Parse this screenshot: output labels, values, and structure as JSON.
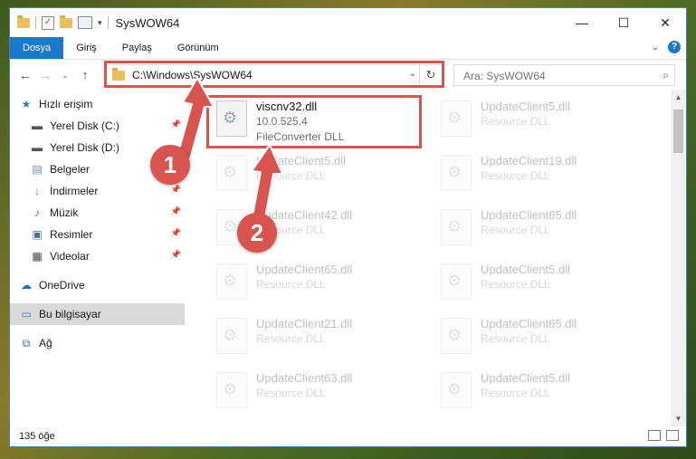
{
  "window": {
    "title": "SysWOW64",
    "controls": {
      "minimize": "—",
      "maximize": "☐",
      "close": "✕"
    }
  },
  "ribbon": {
    "tabs": [
      "Dosya",
      "Giriş",
      "Paylaş",
      "Görünüm"
    ]
  },
  "nav": {
    "address": "C:\\Windows\\SysWOW64",
    "search_placeholder": "Ara: SysWOW64"
  },
  "sidebar": {
    "items": [
      {
        "label": "Hızlı erişim",
        "icon": "star-icon"
      },
      {
        "label": "Yerel Disk (C:)",
        "icon": "drive-icon"
      },
      {
        "label": "Yerel Disk (D:)",
        "icon": "drive-icon"
      },
      {
        "label": "Belgeler",
        "icon": "documents-icon"
      },
      {
        "label": "İndirmeler",
        "icon": "download-icon"
      },
      {
        "label": "Müzik",
        "icon": "music-icon"
      },
      {
        "label": "Resimler",
        "icon": "pictures-icon"
      },
      {
        "label": "Videolar",
        "icon": "video-icon"
      },
      {
        "label": "OneDrive",
        "icon": "cloud-icon"
      },
      {
        "label": "Bu bilgisayar",
        "icon": "computer-icon"
      },
      {
        "label": "Ağ",
        "icon": "network-icon"
      }
    ]
  },
  "files": [
    {
      "name": "viscnv32.dll",
      "version": "10.0.525.4",
      "desc": "FileConverter DLL"
    },
    {
      "name": "UpdateClient5.dll",
      "desc": "Resource DLL"
    },
    {
      "name": "UpdateClient5.dll",
      "desc": "Resource DLL"
    },
    {
      "name": "UpdateClient19.dll",
      "desc": "Resource DLL"
    },
    {
      "name": "UpdateClient42.dll",
      "desc": "Resource DLL"
    },
    {
      "name": "UpdateClient65.dll",
      "desc": "Resource DLL"
    },
    {
      "name": "UpdateClient65.dll",
      "desc": "Resource DLL"
    },
    {
      "name": "UpdateClient5.dll",
      "desc": "Resource DLL"
    },
    {
      "name": "UpdateClient21.dll",
      "desc": "Resource DLL"
    },
    {
      "name": "UpdateClient65.dll",
      "desc": "Resource DLL"
    },
    {
      "name": "UpdateClient63.dll",
      "desc": "Resource DLL"
    },
    {
      "name": "UpdateClient5.dll",
      "desc": "Resource DLL"
    }
  ],
  "status": {
    "count": "135 öğe"
  },
  "annotations": {
    "step1": "1",
    "step2": "2",
    "color": "#d9534f"
  }
}
